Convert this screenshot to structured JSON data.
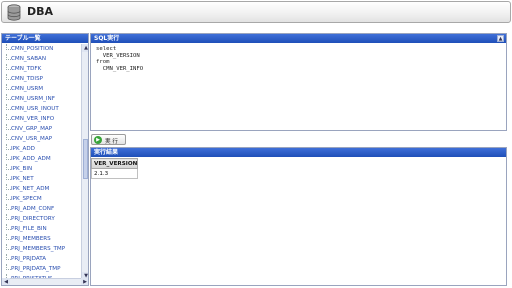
{
  "app": {
    "title": "DBA",
    "logo_icon": "database-icon"
  },
  "table_list": {
    "header": "テーブル一覧",
    "items": [
      "CMN_POSITION",
      "CMN_SABAN",
      "CMN_TDFK",
      "CMN_TDISP",
      "CMN_USRM",
      "CMN_USRM_INF",
      "CMN_USR_INOUT",
      "CMN_VER_INFO",
      "CNV_GRP_MAP",
      "CNV_USR_MAP",
      "IPK_ADD",
      "IPK_ADD_ADM",
      "IPK_BIN",
      "IPK_NET",
      "IPK_NET_ADM",
      "IPK_SPECM",
      "PRJ_ADM_CONF",
      "PRJ_DIRECTORY",
      "PRJ_FILE_BIN",
      "PRJ_MEMBERS",
      "PRJ_MEMBERS_TMP",
      "PRJ_PRJDATA",
      "PRJ_PRJDATA_TMP",
      "PRJ_PRJSTATUS"
    ],
    "scroll_up": "▲",
    "scroll_down": "▼",
    "scroll_left": "◀",
    "scroll_right": "▶"
  },
  "sql_panel": {
    "header": "SQL実行",
    "collapse": "▲",
    "lines": [
      "select",
      "  VER_VERSION",
      "from",
      "  CMN_VER_INFO"
    ]
  },
  "run_button": {
    "label": "実 行",
    "icon": "play-icon",
    "icon_glyph": "▶"
  },
  "result_panel": {
    "header": "実行結果",
    "columns": [
      "VER_VERSION"
    ],
    "rows": [
      [
        "2.1.3"
      ]
    ]
  },
  "colors": {
    "panel_header": "#2f5fc8",
    "link": "#2a4fb0"
  }
}
